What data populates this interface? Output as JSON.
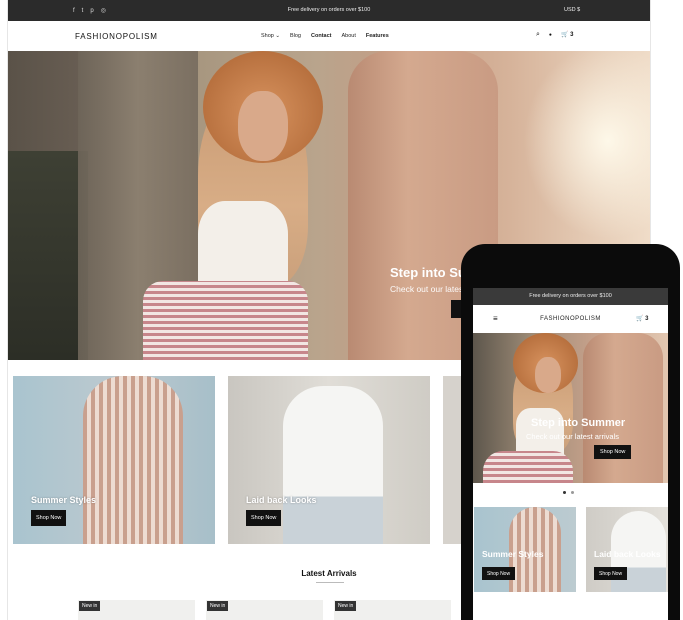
{
  "desktop": {
    "topbar": {
      "social_icons": [
        "facebook-icon",
        "twitter-icon",
        "pinterest-icon",
        "instagram-icon"
      ],
      "social_glyphs": [
        "f",
        "t",
        "p",
        "◎"
      ],
      "promo": "Free delivery on orders over $100",
      "currency": "USD $"
    },
    "nav": {
      "logo": "FASHIONOPOLISM",
      "menu": [
        "Shop ⌄",
        "Blog",
        "Contact",
        "About",
        "Features"
      ],
      "icons": {
        "search": "⌕",
        "account": "●",
        "cart": "🛒 3"
      }
    },
    "hero": {
      "title": "Step into Su",
      "subtitle": "Check out our lates"
    },
    "cards": [
      {
        "title": "Summer Styles",
        "button": "Shop Now"
      },
      {
        "title": "Laid back Looks",
        "button": "Shop Now"
      }
    ],
    "latest_title": "Latest Arrivals",
    "badges": [
      "New in",
      "New in",
      "New in"
    ]
  },
  "phone": {
    "promo": "Free delivery on orders over $100",
    "logo": "FASHIONOPOLISM",
    "burger": "≡",
    "cart": "🛒 3",
    "hero": {
      "title": "Step into Summer",
      "subtitle": "Check out our latest arrivals",
      "button": "Shop Now"
    },
    "cards": [
      {
        "title": "Summer Styles",
        "button": "Shop Now"
      },
      {
        "title": "Laid back Looks",
        "button": "Shop Now"
      }
    ]
  },
  "colors": {
    "topbar": "#2b2b2b",
    "button": "#111111",
    "text": "#222222"
  }
}
